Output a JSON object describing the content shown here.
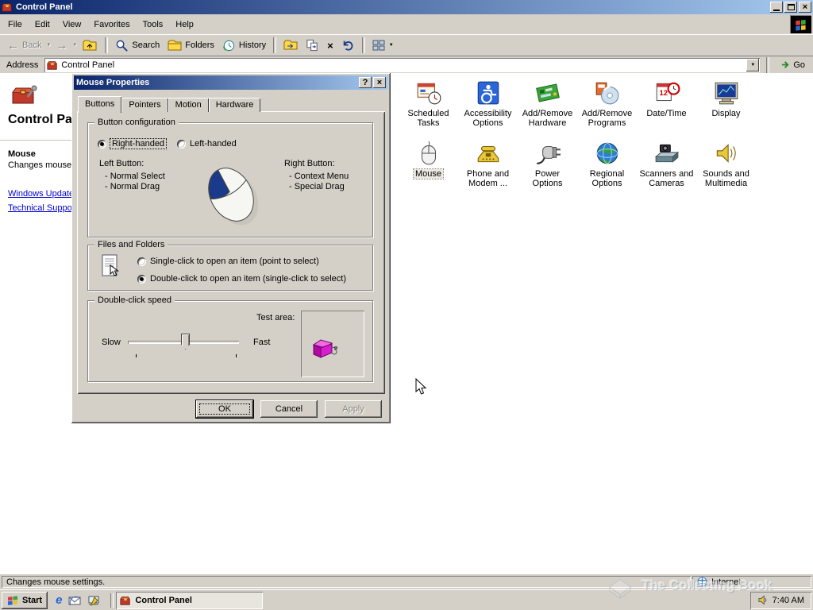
{
  "colors": {
    "chrome": "#d4d0c8",
    "title_gradient_start": "#0a246a",
    "title_gradient_end": "#a6caf0",
    "link": "#0000cc",
    "selection": "#0a246a"
  },
  "glyphs": {
    "close": "×",
    "help": "?",
    "dropdown": "▼",
    "back_arrow": "←",
    "forward_arrow": "→",
    "delete": "×"
  },
  "window": {
    "title": "Control Panel",
    "menu": [
      "File",
      "Edit",
      "View",
      "Favorites",
      "Tools",
      "Help"
    ],
    "toolbar": {
      "back": "Back",
      "search": "Search",
      "folders": "Folders",
      "history": "History"
    },
    "address": {
      "label": "Address",
      "value": "Control Panel",
      "go": "Go"
    }
  },
  "sidebar": {
    "title": "Control Panel",
    "selected_item": "Mouse",
    "selected_desc": "Changes mouse settings.",
    "links": [
      "Windows Update",
      "Technical Support"
    ]
  },
  "dialog": {
    "title": "Mouse Properties",
    "tabs": [
      "Buttons",
      "Pointers",
      "Motion",
      "Hardware"
    ],
    "button_config": {
      "legend": "Button configuration",
      "right_handed": "Right-handed",
      "left_handed": "Left-handed",
      "left_button": "Left Button:",
      "left_items": [
        "- Normal Select",
        "- Normal Drag"
      ],
      "right_button": "Right Button:",
      "right_items": [
        "- Context Menu",
        "- Special Drag"
      ]
    },
    "files_folders": {
      "legend": "Files and Folders",
      "single_click": "Single-click to open an item (point to select)",
      "double_click": "Double-click to open an item (single-click to select)"
    },
    "double_click_speed": {
      "legend": "Double-click speed",
      "test_area": "Test area:",
      "slow": "Slow",
      "fast": "Fast"
    },
    "ok": "OK",
    "cancel": "Cancel",
    "apply": "Apply"
  },
  "icons": {
    "items": [
      {
        "label": "Scheduled Tasks",
        "icon": "scheduled-tasks-icon"
      },
      {
        "label": "Accessibility Options",
        "icon": "accessibility-options-icon"
      },
      {
        "label": "Add/Remove Hardware",
        "icon": "add-remove-hardware-icon"
      },
      {
        "label": "Add/Remove Programs",
        "icon": "add-remove-programs-icon"
      },
      {
        "label": "Date/Time",
        "icon": "date-time-icon"
      },
      {
        "label": "Display",
        "icon": "display-icon"
      },
      {
        "label": "Mouse",
        "icon": "mouse-icon",
        "selected": true
      },
      {
        "label": "Phone and Modem ...",
        "icon": "phone-modem-icon"
      },
      {
        "label": "Power Options",
        "icon": "power-options-icon"
      },
      {
        "label": "Regional Options",
        "icon": "regional-options-icon"
      },
      {
        "label": "Scanners and Cameras",
        "icon": "scanners-cameras-icon"
      },
      {
        "label": "Sounds and Multimedia",
        "icon": "sounds-multimedia-icon"
      }
    ]
  },
  "statusbar": {
    "message": "Changes mouse settings.",
    "zone": "Internet"
  },
  "taskbar": {
    "start": "Start",
    "task": "Control Panel",
    "time": "7:40 AM"
  },
  "watermark": "The Collecting Book"
}
